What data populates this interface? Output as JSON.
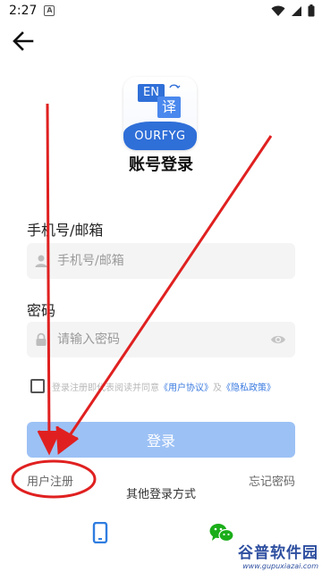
{
  "status_bar": {
    "time": "2:27",
    "app_icon": "a-icon"
  },
  "header": {
    "back_icon": "arrow-left-icon"
  },
  "logo": {
    "badge_en": "EN",
    "badge_yi": "译",
    "brand": "OURFYG"
  },
  "title": "账号登录",
  "account": {
    "label": "手机号/邮箱",
    "placeholder": "手机号/邮箱",
    "icon": "user-icon"
  },
  "password": {
    "label": "密码",
    "placeholder": "请输入密码",
    "icon": "lock-icon"
  },
  "agreement": {
    "prefix": "登录注册即代表阅读并同意",
    "user_agreement": "《用户协议》",
    "and": "及",
    "privacy_policy": "《隐私政策》"
  },
  "login_button": "登录",
  "register_link": "用户注册",
  "forgot_link": "忘记密码",
  "other_login": "其他登录方式",
  "colors": {
    "accent": "#3b7be0",
    "button": "#9cc1f5",
    "annotation": "#e02020"
  },
  "watermark": {
    "title": "谷普软件园",
    "url": "www.gupuxiazai.com"
  }
}
